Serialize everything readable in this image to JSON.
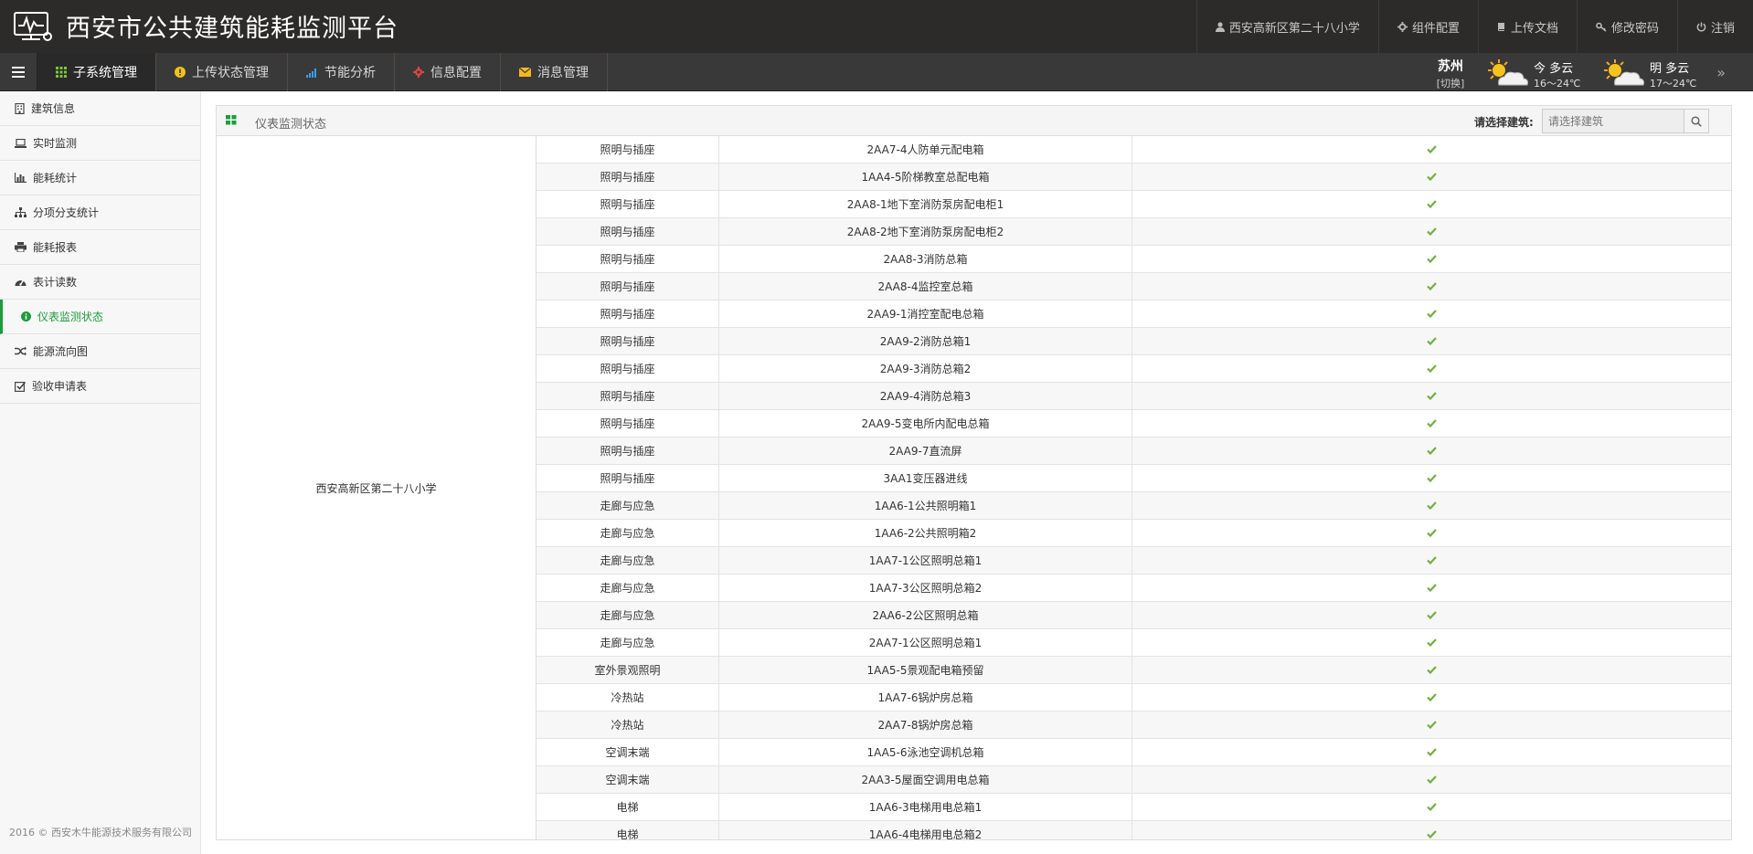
{
  "app": {
    "title": "西安市公共建筑能耗监测平台"
  },
  "header": {
    "links": [
      {
        "label": "西安高新区第二十八小学",
        "icon": "user-icon"
      },
      {
        "label": "组件配置",
        "icon": "gear-icon"
      },
      {
        "label": "上传文档",
        "icon": "book-icon"
      },
      {
        "label": "修改密码",
        "icon": "key-icon"
      },
      {
        "label": "注销",
        "icon": "power-icon"
      }
    ]
  },
  "nav": {
    "tabs": [
      {
        "label": "子系统管理",
        "icon": "grid-icon",
        "active": true
      },
      {
        "label": "上传状态管理",
        "icon": "warning-icon"
      },
      {
        "label": "节能分析",
        "icon": "signal-icon"
      },
      {
        "label": "信息配置",
        "icon": "cog-icon"
      },
      {
        "label": "消息管理",
        "icon": "envelope-icon"
      }
    ]
  },
  "weather": {
    "city": "苏州",
    "switch": "[切换]",
    "today": {
      "day": "今 多云",
      "temp": "16～24℃"
    },
    "tomorrow": {
      "day": "明 多云",
      "temp": "17～24℃"
    },
    "more": "»"
  },
  "sidebar": {
    "items": [
      {
        "label": "建筑信息",
        "icon": "building-icon"
      },
      {
        "label": "实时监测",
        "icon": "laptop-icon"
      },
      {
        "label": "能耗统计",
        "icon": "bar-chart-icon"
      },
      {
        "label": "分项分支统计",
        "icon": "sitemap-icon"
      },
      {
        "label": "能耗报表",
        "icon": "print-icon"
      },
      {
        "label": "表计读数",
        "icon": "dashboard-icon"
      },
      {
        "label": "仪表监测状态",
        "icon": "info-circle-icon",
        "active": true
      },
      {
        "label": "能源流向图",
        "icon": "random-icon"
      },
      {
        "label": "验收申请表",
        "icon": "checkbox-icon"
      }
    ],
    "copyright": "2016 © 西安木牛能源技术服务有限公司"
  },
  "panel": {
    "title": "仪表监测状态",
    "building_label": "请选择建筑:",
    "building_placeholder": "请选择建筑"
  },
  "table": {
    "building": "西安高新区第二十八小学",
    "rows": [
      [
        "照明与插座",
        "2AA7-4人防单元配电箱"
      ],
      [
        "照明与插座",
        "1AA4-5阶梯教室总配电箱"
      ],
      [
        "照明与插座",
        "2AA8-1地下室消防泵房配电柜1"
      ],
      [
        "照明与插座",
        "2AA8-2地下室消防泵房配电柜2"
      ],
      [
        "照明与插座",
        "2AA8-3消防总箱"
      ],
      [
        "照明与插座",
        "2AA8-4监控室总箱"
      ],
      [
        "照明与插座",
        "2AA9-1消控室配电总箱"
      ],
      [
        "照明与插座",
        "2AA9-2消防总箱1"
      ],
      [
        "照明与插座",
        "2AA9-3消防总箱2"
      ],
      [
        "照明与插座",
        "2AA9-4消防总箱3"
      ],
      [
        "照明与插座",
        "2AA9-5变电所内配电总箱"
      ],
      [
        "照明与插座",
        "2AA9-7直流屏"
      ],
      [
        "照明与插座",
        "3AA1变压器进线"
      ],
      [
        "走廊与应急",
        "1AA6-1公共照明箱1"
      ],
      [
        "走廊与应急",
        "1AA6-2公共照明箱2"
      ],
      [
        "走廊与应急",
        "1AA7-1公区照明总箱1"
      ],
      [
        "走廊与应急",
        "1AA7-3公区照明总箱2"
      ],
      [
        "走廊与应急",
        "2AA6-2公区照明总箱"
      ],
      [
        "走廊与应急",
        "2AA7-1公区照明总箱1"
      ],
      [
        "室外景观照明",
        "1AA5-5景观配电箱预留"
      ],
      [
        "冷热站",
        "1AA7-6锅炉房总箱"
      ],
      [
        "冷热站",
        "2AA7-8锅炉房总箱"
      ],
      [
        "空调末端",
        "1AA5-6泳池空调机总箱"
      ],
      [
        "空调末端",
        "2AA3-5屋面空调用电总箱"
      ],
      [
        "电梯",
        "1AA6-3电梯用电总箱1"
      ],
      [
        "电梯",
        "1AA6-4电梯用电总箱2"
      ]
    ],
    "status_icon": "check-icon",
    "status_color": "#6fb13e"
  }
}
